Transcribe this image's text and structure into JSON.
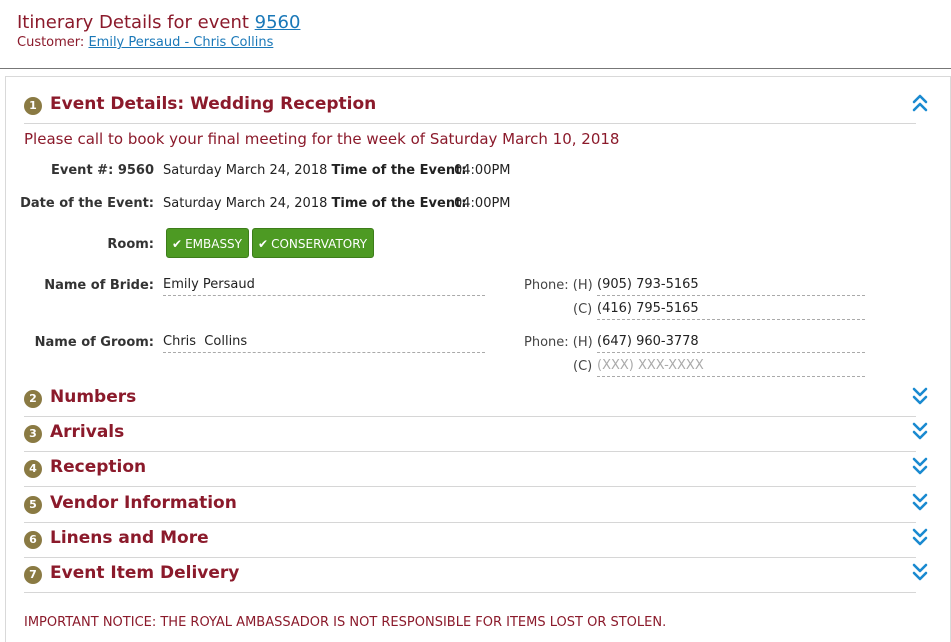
{
  "header": {
    "title_prefix": "Itinerary Details for event",
    "event_link": "9560",
    "customer_label": "Customer:",
    "customer_link": "Emily Persaud - Chris Collins"
  },
  "sections": [
    {
      "num": "1",
      "title": "Event Details: Wedding Reception",
      "expanded": true
    },
    {
      "num": "2",
      "title": "Numbers",
      "expanded": false
    },
    {
      "num": "3",
      "title": "Arrivals",
      "expanded": false
    },
    {
      "num": "4",
      "title": "Reception",
      "expanded": false
    },
    {
      "num": "5",
      "title": "Vendor Information",
      "expanded": false
    },
    {
      "num": "6",
      "title": "Linens and More",
      "expanded": false
    },
    {
      "num": "7",
      "title": "Event Item Delivery",
      "expanded": false
    }
  ],
  "event_details": {
    "meeting_notice": "Please call to book your final meeting for the week of Saturday March 10, 2018",
    "event_num_label": "Event #:",
    "event_num": "9560",
    "event_date_value": "Saturday March 24, 2018",
    "time_label": "Time of the Event:",
    "time_value": "04:00PM",
    "date_label": "Date of the Event:",
    "date_value": "Saturday March 24, 2018",
    "time_label2": "Time of the Event:",
    "time_value2": "04:00PM",
    "room_label": "Room:",
    "rooms": [
      "EMBASSY",
      "CONSERVATORY"
    ],
    "bride_label": "Name of Bride:",
    "bride_name": "Emily Persaud",
    "bride_phone_label": "Phone:",
    "bride_phone_h_label": "(H)",
    "bride_phone_h": "(905) 793-5165",
    "bride_phone_c_label": "(C)",
    "bride_phone_c": "(416) 795-5165",
    "groom_label": "Name of Groom:",
    "groom_name": "Chris  Collins",
    "groom_phone_label": "Phone:",
    "groom_phone_h_label": "(H)",
    "groom_phone_h": "(647) 960-3778",
    "groom_phone_c_label": "(C)",
    "groom_phone_c_placeholder": "(XXX) XXX-XXXX"
  },
  "bottom_notice": "IMPORTANT NOTICE: THE ROYAL AMBASSADOR IS NOT RESPONSIBLE FOR ITEMS LOST OR STOLEN.",
  "colors": {
    "heading": "#8b1a2b",
    "link": "#1a78b8",
    "badge": "#8a7a43",
    "room_button": "#4d9a23",
    "chevron": "#1a8ad0"
  }
}
